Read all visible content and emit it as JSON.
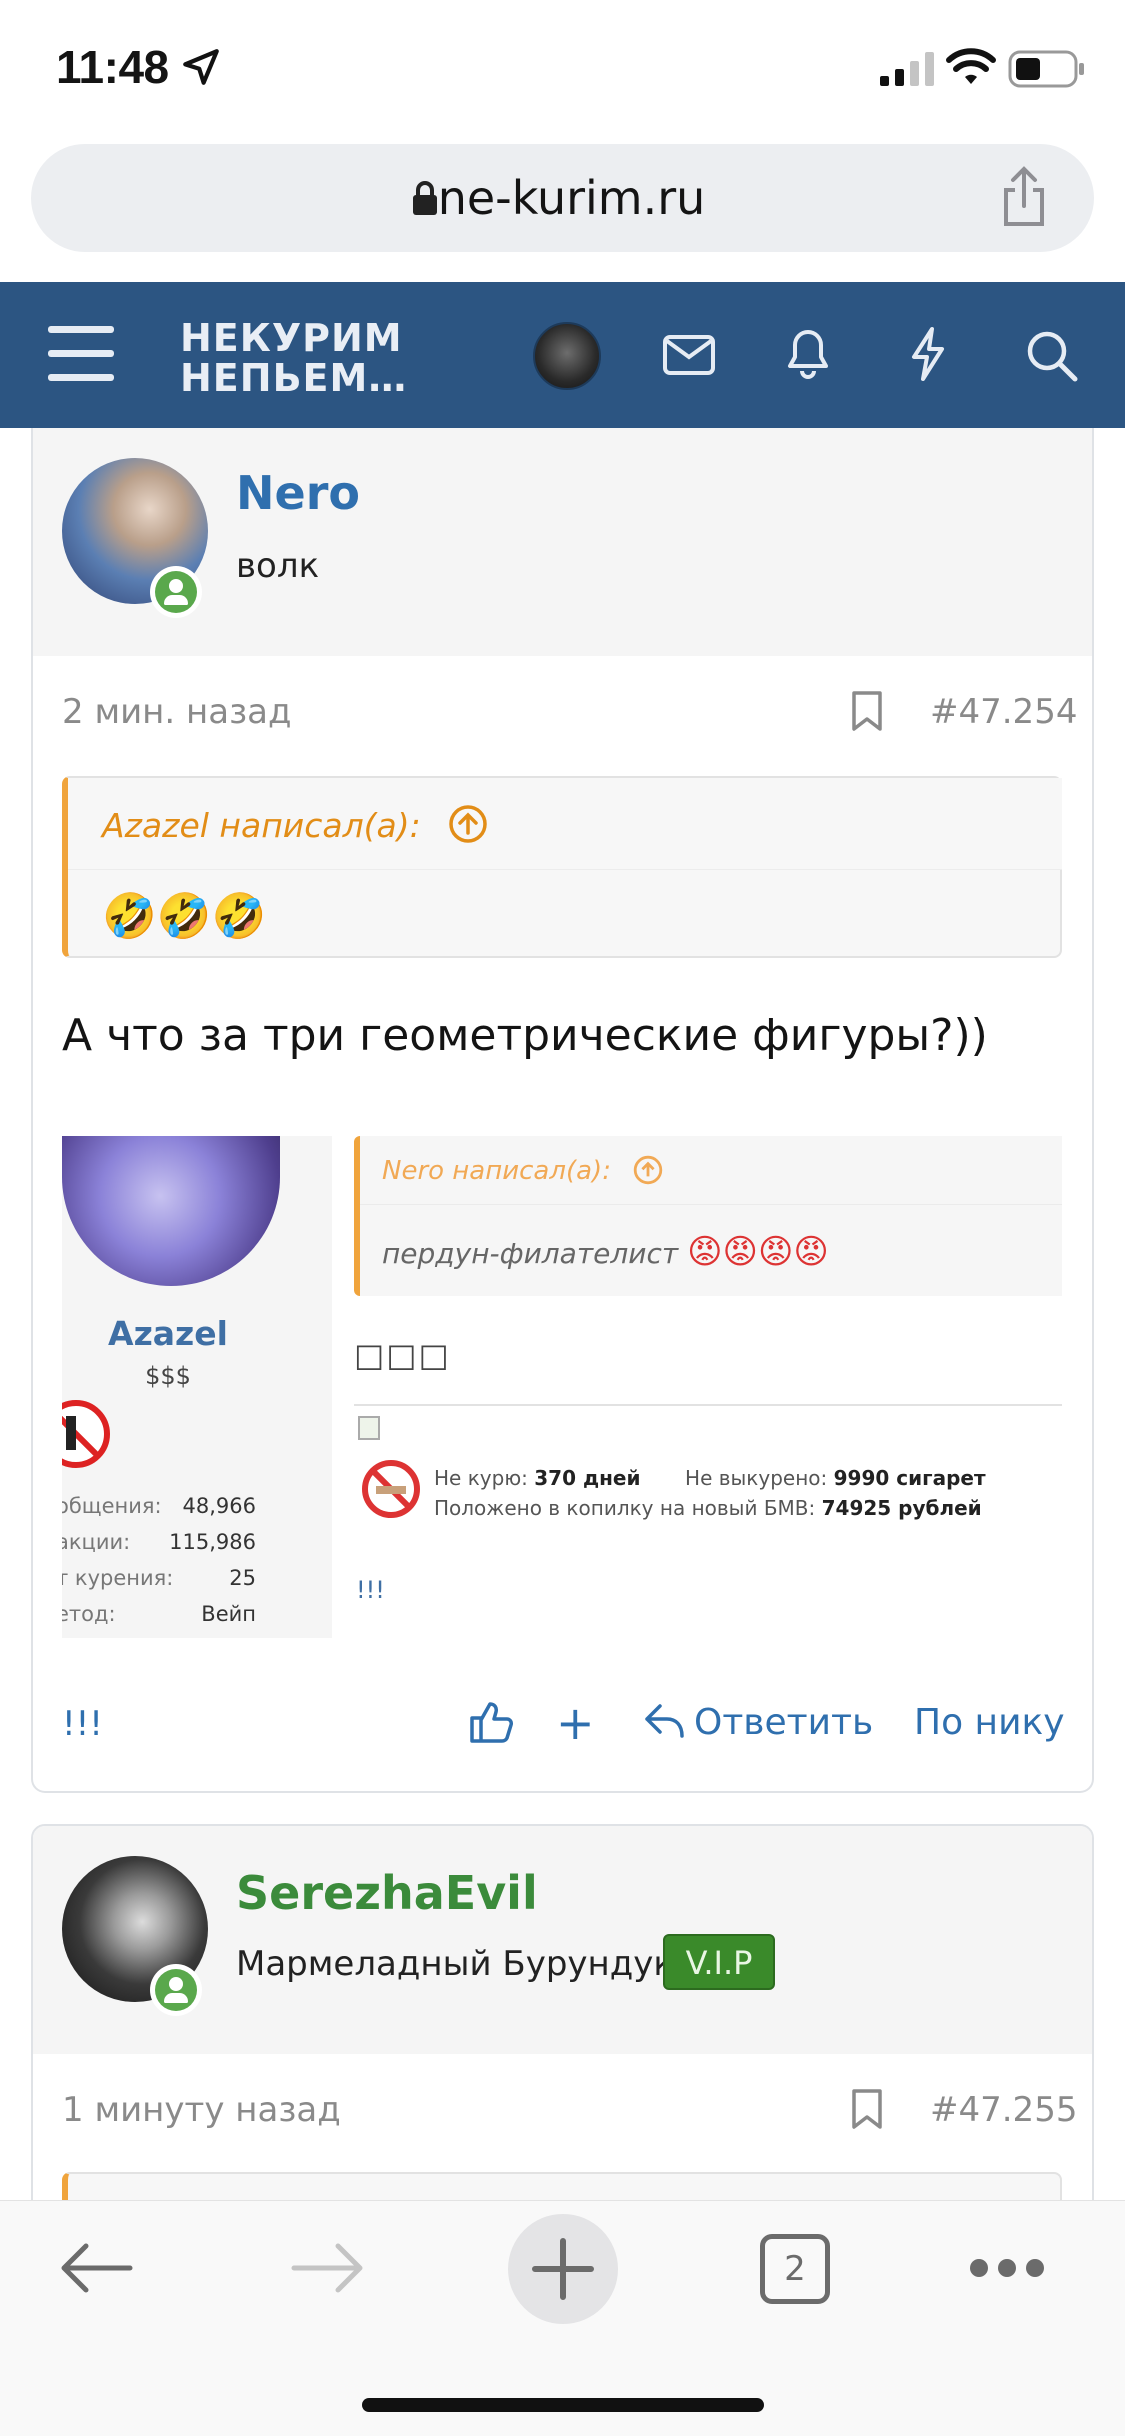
{
  "status_bar": {
    "time": "11:48"
  },
  "browser": {
    "url": "ne-kurim.ru",
    "tabs_count": "2"
  },
  "site": {
    "logo_line1": "НЕКУРИМ",
    "logo_line2": "НЕПЬЕМ…"
  },
  "posts": [
    {
      "username": "Nero",
      "user_title": "волк",
      "time": "2 мин. назад",
      "number": "#47.254",
      "quote": {
        "attribution": "Azazel написал(а):",
        "content": "🤣🤣🤣"
      },
      "body": "А что за три геометрические фигуры?))",
      "embedded": {
        "username": "Azazel",
        "user_title": "$$$",
        "stats": [
          {
            "label": "общения:",
            "value": "48,966"
          },
          {
            "label": "акции:",
            "value": "115,986"
          },
          {
            "label": "т курения:",
            "value": "25"
          },
          {
            "label": "етод:",
            "value": "Вейп"
          }
        ],
        "quote_attribution": "Nero написал(а):",
        "quote_text": "пердун-филателист",
        "quote_emoji": "😡😡😡😡",
        "body": "□□□",
        "signature": {
          "l1a": "Не курю:",
          "l1b": "370 дней",
          "l1c": "Не выкурено:",
          "l1d": "9990 сигарет",
          "l2a": "Положено в копилку на новый БМВ:",
          "l2b": "74925 рублей"
        },
        "footer": "!!!"
      },
      "signature_text": "!!!",
      "actions": {
        "plus": "+",
        "reply": "Ответить",
        "by_nick": "По нику"
      }
    },
    {
      "username": "SerezhaEvil",
      "user_title": "Мармеладный Бурундук",
      "badge": "V.I.P",
      "time": "1 минуту назад",
      "number": "#47.255"
    }
  ],
  "colors": {
    "nav_bg": "#2c5582",
    "link_blue": "#2f6fae",
    "quote_orange": "#f0a43c",
    "vip_green": "#3a8a2a",
    "username_green": "#3b8b3b"
  }
}
